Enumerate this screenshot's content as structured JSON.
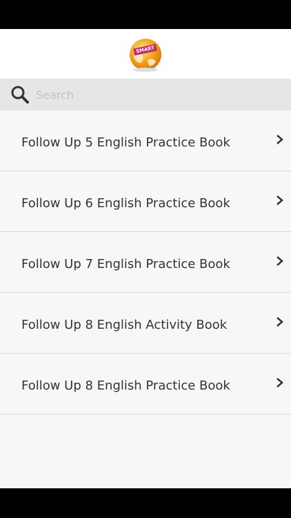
{
  "header": {
    "logo_icon": "smart-english-globe-icon",
    "logo_text": "SMART"
  },
  "search": {
    "placeholder": "Search",
    "icon": "search-icon"
  },
  "books": [
    {
      "label": "Follow Up 5 English Practice Book"
    },
    {
      "label": "Follow Up 6 English Practice Book"
    },
    {
      "label": "Follow Up 7 English Practice Book"
    },
    {
      "label": "Follow Up 8 English Activity Book"
    },
    {
      "label": "Follow Up 8 English Practice Book"
    }
  ],
  "colors": {
    "accent": "#c2266f",
    "globe_orange": "#f3a21b",
    "list_background": "#f7f7f7",
    "search_background": "#e6e6e6"
  }
}
